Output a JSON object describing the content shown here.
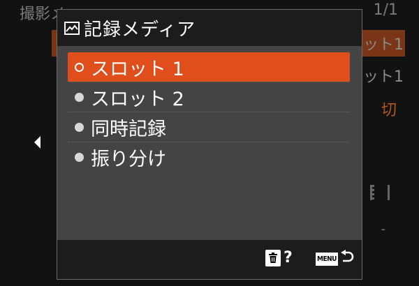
{
  "background": {
    "breadcrumb": "撮影メ",
    "page_indicator": "1/1",
    "right_value_1": "ット1",
    "right_value_2": "ット1",
    "right_value_3": "切",
    "right_value_4": "-"
  },
  "dialog": {
    "icon": "media-card-icon",
    "title": "記録メディア",
    "options": [
      {
        "label": "スロット 1",
        "selected": true
      },
      {
        "label": "スロット 2",
        "selected": false
      },
      {
        "label": "同時記録",
        "selected": false
      },
      {
        "label": "振り分け",
        "selected": false
      }
    ],
    "footer": {
      "help_icon": "trash-icon",
      "help_mark": "?",
      "menu_key": "MENU",
      "back_icon": "return-arrow-icon"
    }
  },
  "colors": {
    "selection": "#e04e1b",
    "dialog_bg": "#444444",
    "header_bg": "#1c1c1c"
  }
}
